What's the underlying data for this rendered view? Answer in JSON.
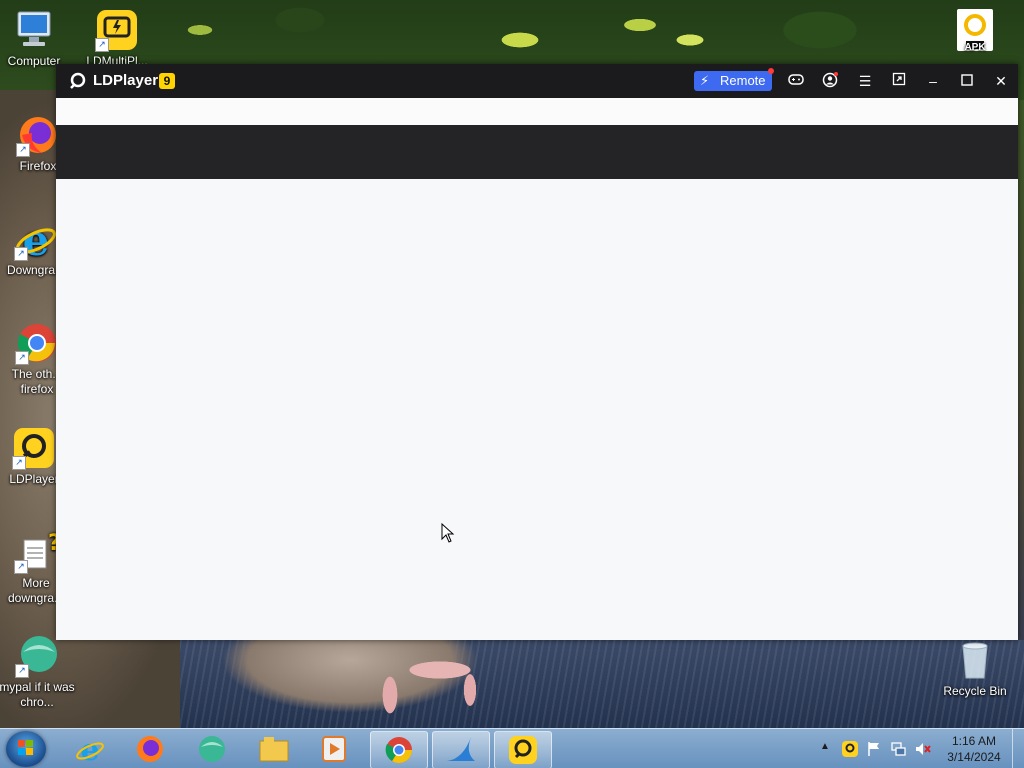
{
  "desktop": {
    "icons": [
      {
        "id": "computer",
        "label": "Computer"
      },
      {
        "id": "ldmultiplayer",
        "label": "LDMultiPl..."
      },
      {
        "id": "apk",
        "label": "APK"
      },
      {
        "id": "firefox",
        "label": "Firefox"
      },
      {
        "id": "downgrade",
        "label": "Downgra..."
      },
      {
        "id": "chrome",
        "label": "The oth... firefox"
      },
      {
        "id": "ldplayer",
        "label": "LDPlayer"
      },
      {
        "id": "more",
        "label": "More downgra..."
      },
      {
        "id": "mypal",
        "label": "mypal if it was chro..."
      },
      {
        "id": "recycle",
        "label": "Recycle Bin"
      }
    ]
  },
  "window": {
    "title": "LDPlayer",
    "version": "9",
    "remote_label": "Remote",
    "colors": {
      "titlebar": "#1b1b1e",
      "remote": "#3d6af0",
      "badge": "#ffd400"
    }
  },
  "taskbar": {
    "apps": [
      "ie-icon",
      "firefox-icon",
      "mypal-icon",
      "explorer-icon",
      "media-player-icon",
      "chrome-icon",
      "shark-icon",
      "ldplayer-icon"
    ],
    "time": "1:16 AM",
    "date": "3/14/2024"
  }
}
